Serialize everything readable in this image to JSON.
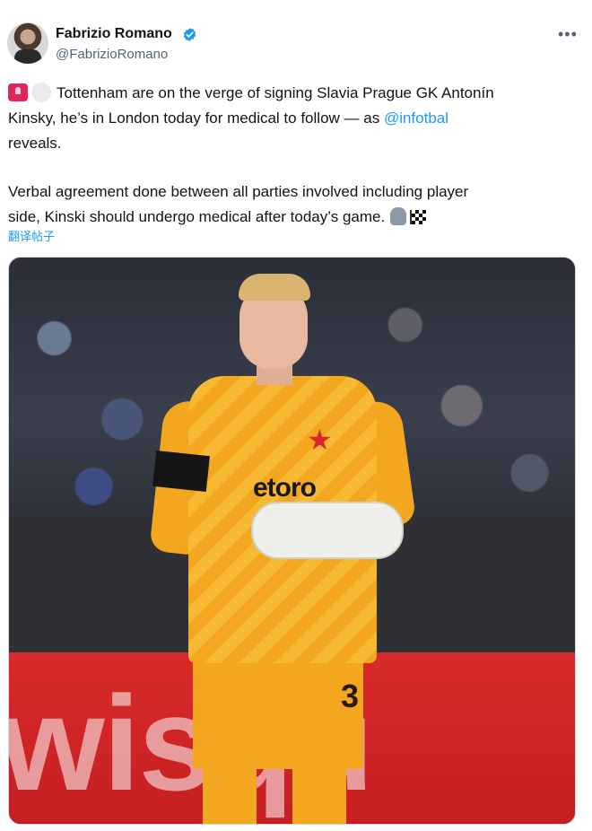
{
  "author": {
    "display_name": "Fabrizio Romano",
    "handle": "@FabrizioRomano",
    "verified": true,
    "avatar_icon": "profile-avatar"
  },
  "menu": {
    "more_label": "•••"
  },
  "tweet": {
    "line1": "Tottenham are on the verge of signing Slavia Prague GK Antonín",
    "line2_before": "Kinsky, he’s in London today for medical to follow — as ",
    "mention": "@infotbal",
    "line3": "reveals.",
    "line4": "Verbal agreement done between all parties involved including player",
    "line5": "side, Kinski should undergo medical after today’s game.",
    "emojis": [
      "siren-emoji",
      "white-circle-emoji",
      "glove-emoji",
      "checkered-flag-emoji"
    ]
  },
  "translate_label": "翻译帖子",
  "media": {
    "sponsor_text": "etoro",
    "shirt_number": "3",
    "ad_board_text": "wisqu"
  },
  "colors": {
    "link": "#1d9bf0",
    "text": "#0f1419",
    "secondary": "#536471",
    "jersey": "#f2a71e"
  }
}
